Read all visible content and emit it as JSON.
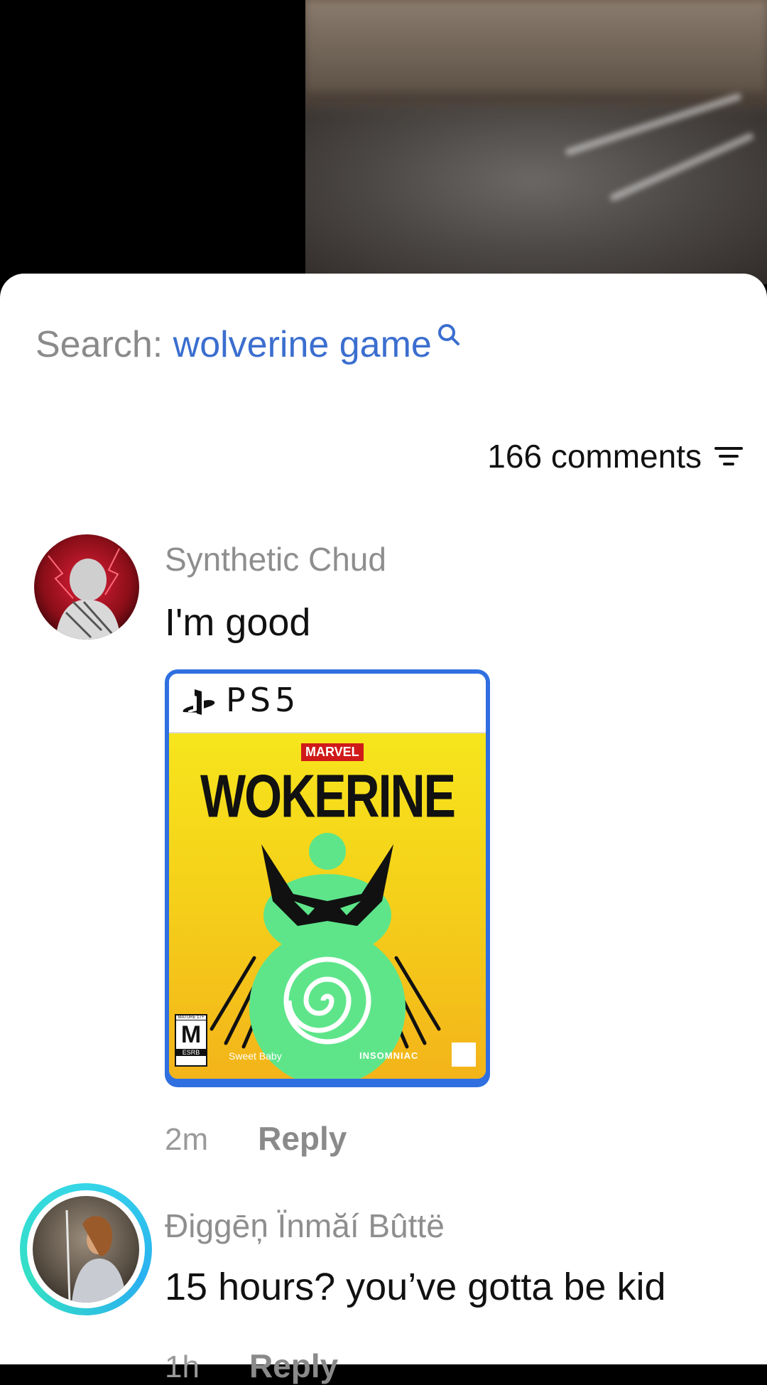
{
  "search": {
    "prefix": "Search: ",
    "query": "wolverine game"
  },
  "comments_count": "166 comments",
  "comments": [
    {
      "username": "Synthetic Chud",
      "text": "I'm good",
      "image": {
        "platform": "PS5",
        "publisher_badge": "MARVEL",
        "title": "WOKERINE",
        "rating": "M",
        "rating_header": "MATURE 17+",
        "rating_footer": "ESRB",
        "studio_left": "Sweet Baby",
        "studio_right": "INSOMNIAC"
      },
      "time": "2m",
      "reply": "Reply"
    },
    {
      "username": "Điggēņ Ïnmăí Bûttë",
      "text": "15 hours? you’ve gotta be kid",
      "time": "1h",
      "reply": "Reply"
    }
  ],
  "colors": {
    "search_query": "#3b6ecf",
    "muted": "#8e8e8e",
    "cover_frame": "#2f6fe0",
    "cover_yellow": "#f6e51c",
    "mascot_green": "#5ee58a"
  },
  "icons": [
    "search-icon",
    "sort-icon",
    "playstation-logo-icon",
    "wolverine-mask-icon",
    "swirl-icon"
  ]
}
